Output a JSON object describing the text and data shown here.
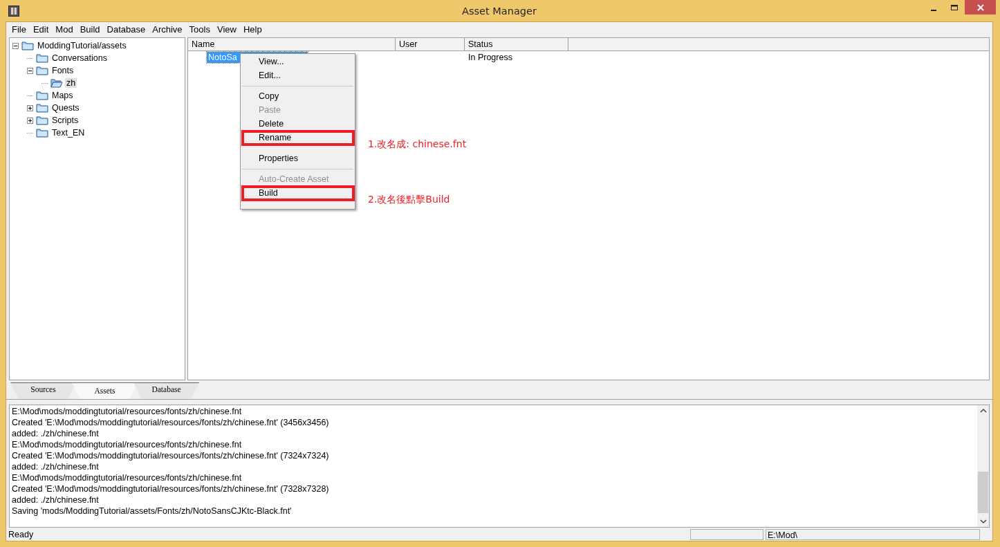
{
  "window": {
    "title": "Asset Manager"
  },
  "menu_bar": [
    "File",
    "Edit",
    "Mod",
    "Build",
    "Database",
    "Archive",
    "Tools",
    "View",
    "Help"
  ],
  "tree": [
    {
      "label": "ModdingTutorial/assets",
      "expanded": true,
      "selected": false,
      "children": [
        {
          "label": "Conversations",
          "selected": false
        },
        {
          "label": "Fonts",
          "expanded": true,
          "selected": false,
          "children": [
            {
              "label": "zh",
              "selected": true,
              "open": true
            }
          ]
        },
        {
          "label": "Maps",
          "selected": false
        },
        {
          "label": "Quests",
          "expanded": false,
          "selected": false
        },
        {
          "label": "Scripts",
          "expanded": false,
          "selected": false
        },
        {
          "label": "Text_EN",
          "selected": false
        }
      ]
    }
  ],
  "table": {
    "columns": [
      "Name",
      "User",
      "Status"
    ],
    "rows": [
      {
        "name": "NotoSa",
        "status": "In Progress",
        "selected": true
      }
    ]
  },
  "context_menu": [
    {
      "kind": "item",
      "label": "View...",
      "disabled": false
    },
    {
      "kind": "item",
      "label": "Edit...",
      "disabled": false
    },
    {
      "kind": "separator"
    },
    {
      "kind": "item",
      "label": "Copy",
      "disabled": false
    },
    {
      "kind": "item",
      "label": "Paste",
      "disabled": true
    },
    {
      "kind": "item",
      "label": "Delete",
      "disabled": false
    },
    {
      "kind": "item",
      "label": "Rename",
      "disabled": false,
      "note": "1.改名成: chinese.fnt"
    },
    {
      "kind": "item",
      "label": "Properties",
      "disabled": false
    },
    {
      "kind": "separator"
    },
    {
      "kind": "item",
      "label": "Auto-Create Asset",
      "disabled": true
    },
    {
      "kind": "item",
      "label": "Build",
      "disabled": false,
      "note": "2.改名後點擊Build"
    }
  ],
  "tabs": [
    {
      "label": "Sources",
      "selected": false
    },
    {
      "label": "Assets",
      "selected": true
    },
    {
      "label": "Database",
      "selected": false
    }
  ],
  "log": [
    "E:\\Mod\\mods/moddingtutorial/resources/fonts/zh/chinese.fnt",
    "Created 'E:\\Mod\\mods/moddingtutorial/resources/fonts/zh/chinese.fnt' (3456x3456)",
    "added: ./zh/chinese.fnt",
    "E:\\Mod\\mods/moddingtutorial/resources/fonts/zh/chinese.fnt",
    "Created 'E:\\Mod\\mods/moddingtutorial/resources/fonts/zh/chinese.fnt' (7324x7324)",
    "added: ./zh/chinese.fnt",
    "E:\\Mod\\mods/moddingtutorial/resources/fonts/zh/chinese.fnt",
    "Created 'E:\\Mod\\mods/moddingtutorial/resources/fonts/zh/chinese.fnt' (7328x7328)",
    "added: ./zh/chinese.fnt",
    "Saving 'mods/ModdingTutorial/assets/Fonts/zh/NotoSansCJKtc-Black.fnt'"
  ],
  "status_bar": {
    "message": "Ready",
    "path": "E:\\Mod\\"
  }
}
